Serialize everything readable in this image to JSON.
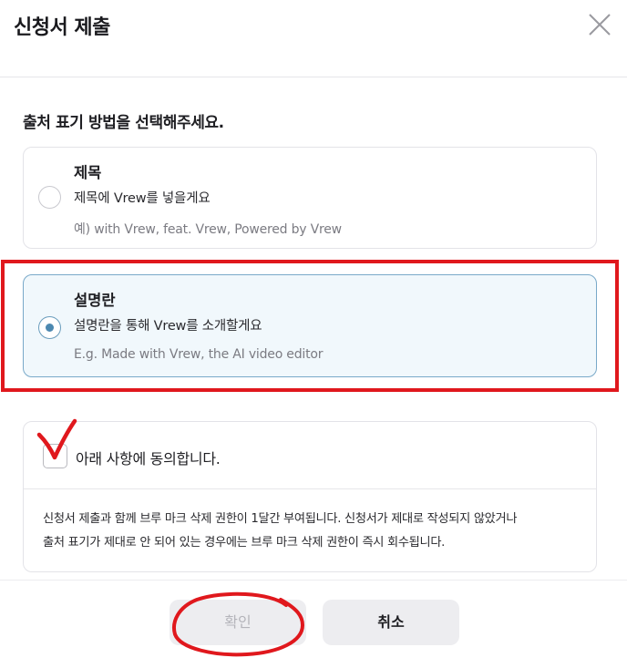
{
  "dialog": {
    "title": "신청서 제출",
    "close_icon": "close-icon"
  },
  "question": "출처 표기 방법을 선택해주세요.",
  "options": [
    {
      "title": "제목",
      "description": "제목에 Vrew를 넣을게요",
      "example": "예) with Vrew, feat. Vrew, Powered by Vrew",
      "selected": false
    },
    {
      "title": "설명란",
      "description": "설명란을 통해 Vrew를 소개할게요",
      "example": "E.g. Made with Vrew, the AI video editor",
      "selected": true
    }
  ],
  "agreement": {
    "label": "아래 사항에 동의합니다.",
    "checked": false,
    "text_line1": "신청서 제출과 함께 브루 마크 삭제 권한이 1달간 부여됩니다. 신청서가 제대로 작성되지 않았거나",
    "text_line2": "출처 표기가 제대로 안 되어 있는 경우에는 브루 마크 삭제 권한이 즉시 회수됩니다."
  },
  "buttons": {
    "confirm": "확인",
    "cancel": "취소"
  },
  "colors": {
    "annotation_red": "#e0181d",
    "selected_bg": "#f1f8fc",
    "selected_border": "#79a9c9",
    "radio_dot": "#4c88b0"
  }
}
